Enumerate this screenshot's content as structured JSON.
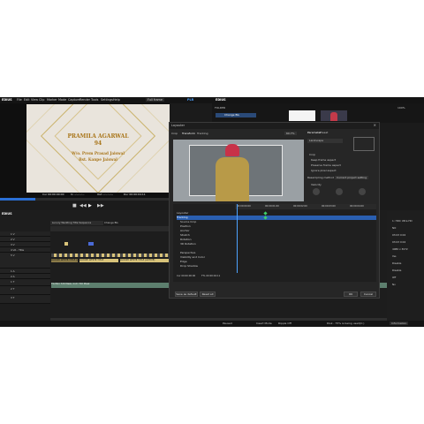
{
  "menubar": {
    "app_name": "EDIUS",
    "items": [
      "File",
      "Edit",
      "View",
      "Clip",
      "Marker",
      "Mode",
      "Capture",
      "Render",
      "Tools",
      "Settings",
      "Help"
    ],
    "preset": "Full frame",
    "plr": "PLR"
  },
  "preview": {
    "name": "PRAMILA AGARWAL",
    "age": "94",
    "line1": "W/o. Prem Prasad Jaiswal",
    "line2": "Bst. Kanpe Jaiswal",
    "cur_timecode": "Cur 00:00:00:00",
    "in_timecode": "In --:--:--:--",
    "out_timecode": "Out --:--:--:--",
    "dur_timecode": "Dur 00:00:04:11"
  },
  "bin": {
    "folder_label": "FOLDER",
    "item_label": "Change BG",
    "zoom": "100%"
  },
  "dialog": {
    "title": "Layouter",
    "tabs": [
      "Crop",
      "Transform",
      "Tracking"
    ],
    "zoom_select": "60.7%",
    "right_tabs": [
      "Parameter",
      "Preset"
    ],
    "preset_select": "Landscape",
    "crop_label": "Crop",
    "options": [
      "Keep frame aspect",
      "Preserve frame aspect",
      "Ignore pixel aspect"
    ],
    "resample_label": "Resampling method",
    "resample_value": "Current project setting",
    "velocity_label": "Velocity",
    "tree": [
      "Layouter",
      "Tracking",
      "Source Crop",
      "Position",
      "Anchor",
      "Stretch",
      "Rotation",
      "3D Rotation",
      "Perspective",
      "Visibility and Color",
      "Edge",
      "Drop Shadow"
    ],
    "tl_times": [
      "00:00:00:00",
      "00:00:01:00",
      "00:00:02:00",
      "00:00:03:00",
      "00:00:04:00"
    ],
    "cur_tc": "Cur 00:00:00:00",
    "ttl_tc": "TTL 00:00:04:11",
    "save_default": "Save as default",
    "reset_all": "Reset all",
    "ok": "OK",
    "cancel": "Cancel"
  },
  "timeline": {
    "sequence": "Luxury Wedding Title Sequence",
    "clip_label": "Change BG",
    "tracks": [
      "1 V",
      "2 V",
      "3 V",
      "4 VA - Title",
      "5 V",
      "1 A",
      "2 A",
      "1 T",
      "2 T",
      "3 T"
    ],
    "clips": [
      "LUXURY WHITE TITLE",
      "LUXURY WHITE TITLE (ACTIVE)",
      "LUXURY WHITE TITLE (ACTIVE)"
    ],
    "audio_clip": "TG Mini 720 Mask, Inch 720 Mask"
  },
  "right_panel": {
    "items": [
      "1: HDC Ultra HD",
      "NO",
      "03:03 0:02",
      "03:03 0:02",
      "4080 x 3072",
      "Yes",
      "Disable",
      "Disable",
      "Off",
      "Nv"
    ]
  },
  "status": {
    "paused": "Paused",
    "insert": "Insert Mode",
    "ripple": "Ripple Off",
    "disk": "Disk - 75% is being used(C:)",
    "info": "Information"
  },
  "colors": {
    "accent": "#2a6fd6",
    "gold": "#b07d1e",
    "clip": "#d8c37a",
    "dark": "#1b1b1b"
  }
}
